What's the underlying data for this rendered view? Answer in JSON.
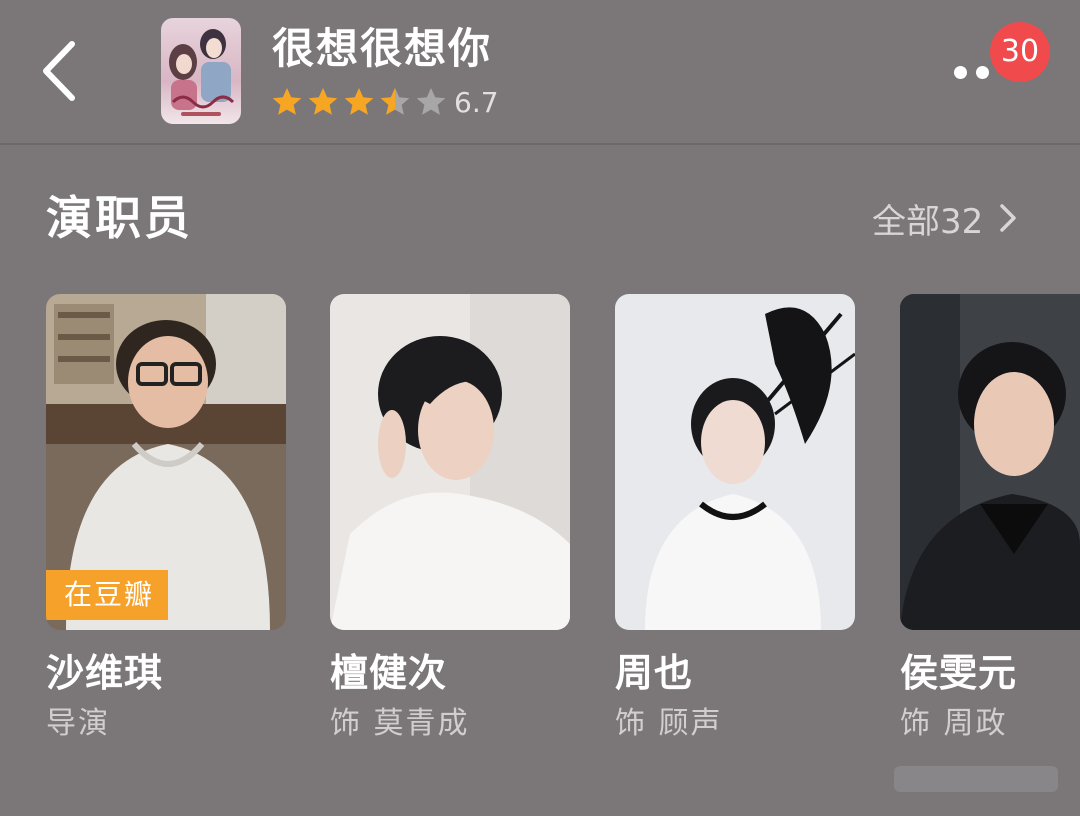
{
  "header": {
    "title": "很想很想你",
    "rating": {
      "value": "6.7",
      "stars_out_of_5": 3.5
    },
    "more_icon": "more-dots-icon",
    "notification_count": "30",
    "colors": {
      "badge": "#f04a4c",
      "star_on": "#f6a623",
      "star_off": "#a9a6a8"
    }
  },
  "cast_section": {
    "title": "演职员",
    "see_all_label": "全部32",
    "see_all_icon": "chevron-right-icon",
    "members": [
      {
        "name": "沙维琪",
        "role": "导演",
        "tag": "在豆瓣"
      },
      {
        "name": "檀健次",
        "role": "饰 莫青成"
      },
      {
        "name": "周也",
        "role": "饰 顾声"
      },
      {
        "name": "侯雯元",
        "role": "饰 周政"
      }
    ]
  }
}
